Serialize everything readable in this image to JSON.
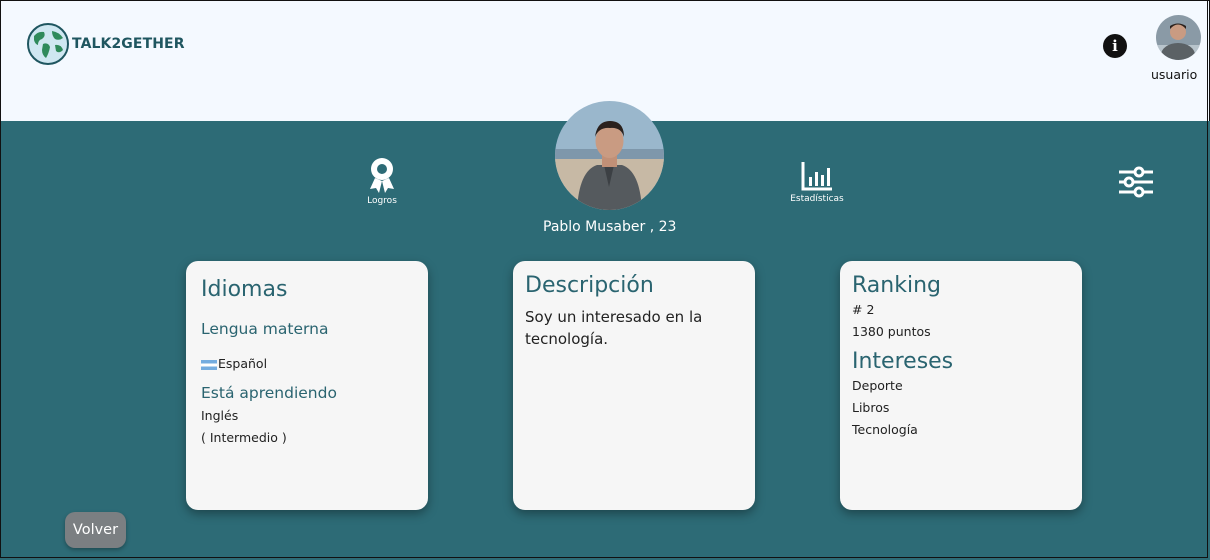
{
  "header": {
    "app_name": "TALK2GETHER",
    "user_label": "usuario"
  },
  "profile": {
    "name_age": "Pablo Musaber , 23"
  },
  "nav": {
    "logros_label": "Logros",
    "stats_label": "Estadísticas"
  },
  "idiomas": {
    "title": "Idiomas",
    "native_heading": "Lengua materna",
    "native_language": "Español",
    "learning_heading": "Está aprendiendo",
    "learning_language": "Inglés",
    "learning_level": "( Intermedio )"
  },
  "descripcion": {
    "title": "Descripción",
    "text": "Soy un interesado en la tecnología."
  },
  "ranking": {
    "title": "Ranking",
    "position": "# 2",
    "points": "1380 puntos"
  },
  "intereses": {
    "title": "Intereses",
    "items": [
      "Deporte",
      "Libros",
      "Tecnología"
    ]
  },
  "footer": {
    "back_label": "Volver"
  },
  "colors": {
    "teal_background": "#2d6b76",
    "header_background": "#f4f9ff",
    "heading_teal": "#2a6470",
    "back_button": "#7b7f82"
  },
  "icons": [
    "globe-logo-icon",
    "info-icon",
    "award-icon",
    "bar-chart-icon",
    "sliders-icon"
  ]
}
